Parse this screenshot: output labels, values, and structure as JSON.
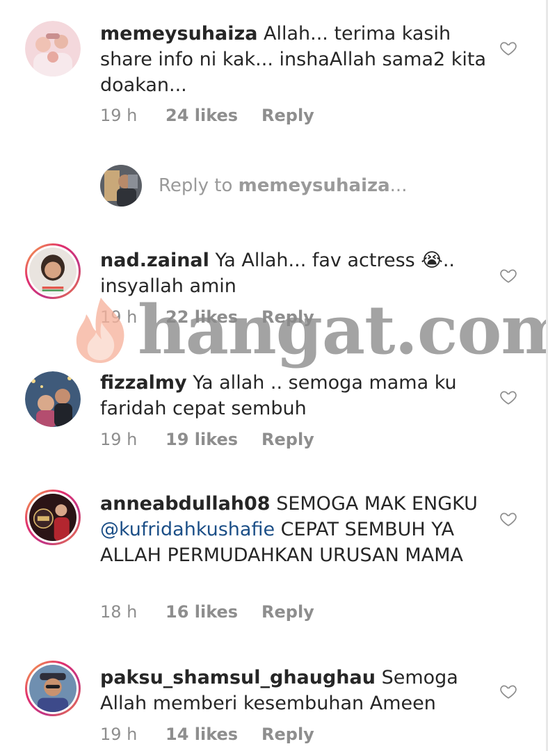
{
  "comments": [
    {
      "username": "memeysuhaiza",
      "text": " Allah... terima kasih share info ni kak... inshaAllah sama2 kita doakan...",
      "time": "19 h",
      "likes": "24 likes",
      "reply": "Reply"
    },
    {
      "username": "nad.zainal",
      "text": " Ya Allah... fav actress 😭.. insyallah amin",
      "time": "19 h",
      "likes": "22 likes",
      "reply": "Reply"
    },
    {
      "username": "fizzalmy",
      "text": " Ya allah .. semoga mama ku faridah cepat sembuh",
      "time": "19 h",
      "likes": "19 likes",
      "reply": "Reply"
    },
    {
      "username": "anneabdullah08",
      "text_before": " SEMOGA MAK ENGKU ",
      "mention": "@kufridahkushafie",
      "text_after": " CEPAT SEMBUH YA ALLAH PERMUDAHKAN URUSAN MAMA",
      "time": "18 h",
      "likes": "16 likes",
      "reply": "Reply"
    },
    {
      "username": "paksu_shamsul_ghaughau",
      "text": " Semoga Allah memberi kesembuhan Ameen",
      "time": "19 h",
      "likes": "14 likes",
      "reply": "Reply"
    }
  ],
  "reply_prompt": {
    "prefix": "Reply to ",
    "username": "memeysuhaiza",
    "suffix": "..."
  },
  "watermark": {
    "text": "hangat.com"
  },
  "icons": {
    "like": "heart-outline-icon"
  },
  "colors": {
    "mention": "#1c4f87",
    "meta": "#8e8e8e",
    "story_ring_start": "#f9c046",
    "story_ring_end": "#c13584"
  }
}
